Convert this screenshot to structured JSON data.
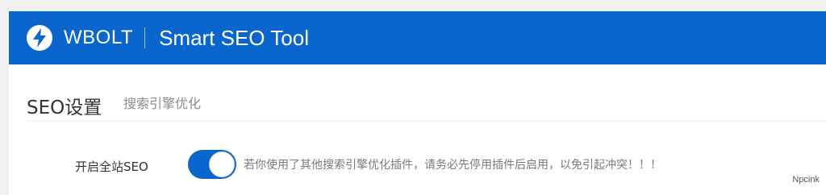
{
  "header": {
    "brand": "WBOLT",
    "product": "Smart SEO Tool",
    "logo_icon": "lightning-bolt-icon",
    "background_color": "#0a66cc"
  },
  "section": {
    "title": "SEO设置",
    "subtitle": "搜索引擎优化"
  },
  "settings": {
    "enable_seo": {
      "label": "开启全站SEO",
      "enabled": true,
      "hint": "若你使用了其他搜索引擎优化插件，请务必先停用插件后启用，以免引起冲突！！！"
    }
  },
  "watermark": "Npcink"
}
